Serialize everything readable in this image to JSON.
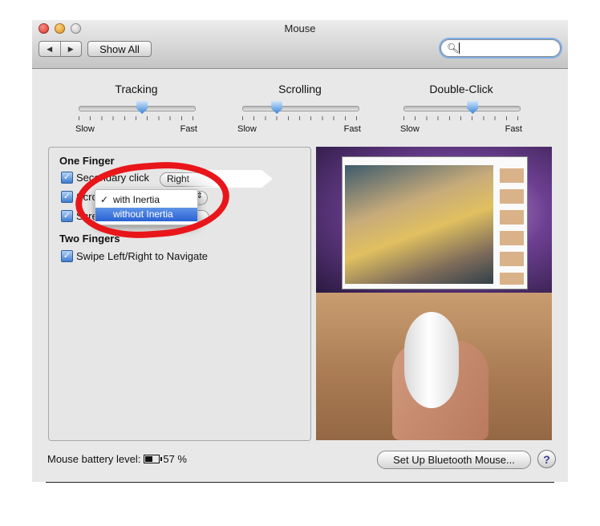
{
  "window": {
    "title": "Mouse"
  },
  "toolbar": {
    "back_glyph": "◀",
    "forward_glyph": "▶",
    "show_all_label": "Show All",
    "search_icon": "magnifier-icon",
    "search_value": ""
  },
  "sliders": {
    "tracking": {
      "title": "Tracking",
      "min_label": "Slow",
      "max_label": "Fast",
      "value": 0.55
    },
    "scrolling": {
      "title": "Scrolling",
      "min_label": "Slow",
      "max_label": "Fast",
      "value": 0.3
    },
    "double_click": {
      "title": "Double-Click",
      "min_label": "Slow",
      "max_label": "Fast",
      "value": 0.6
    }
  },
  "gestures": {
    "one_finger_title": "One Finger",
    "secondary_click_label": "Secondary click",
    "secondary_click_value": "Right",
    "scroll_label": "Scro",
    "screen_zoom_label": "Scre",
    "two_fingers_title": "Two Fingers",
    "swipe_label": "Swipe Left/Right to Navigate"
  },
  "scroll_menu": {
    "check_glyph": "✓",
    "options": [
      "with Inertia",
      "without Inertia"
    ],
    "checked_option": "with Inertia",
    "highlighted_option": "without Inertia"
  },
  "footer": {
    "battery_label": "Mouse battery level:",
    "battery_value": "57 %",
    "setup_button": "Set Up Bluetooth Mouse...",
    "help_glyph": "?"
  },
  "colors": {
    "annotation": "#e8161a",
    "highlight": "#2a62d4"
  }
}
